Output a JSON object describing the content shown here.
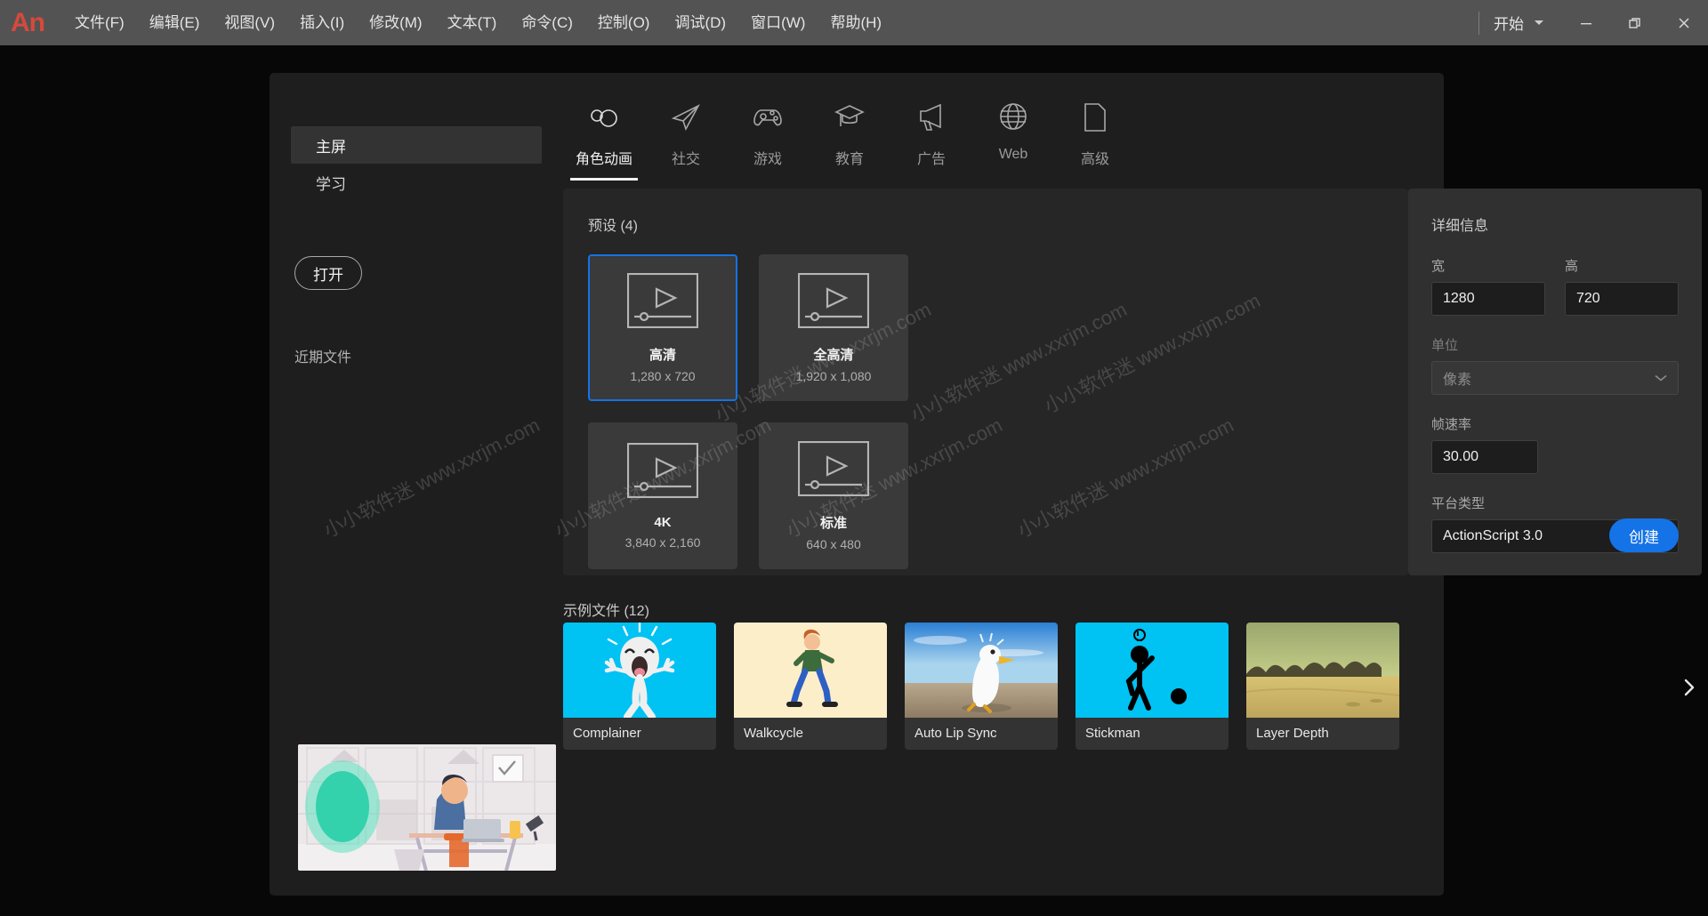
{
  "app": {
    "logo": "An"
  },
  "menubar": {
    "items": [
      {
        "label": "文件(F)",
        "name": "menu-file"
      },
      {
        "label": "编辑(E)",
        "name": "menu-edit"
      },
      {
        "label": "视图(V)",
        "name": "menu-view"
      },
      {
        "label": "插入(I)",
        "name": "menu-insert"
      },
      {
        "label": "修改(M)",
        "name": "menu-modify"
      },
      {
        "label": "文本(T)",
        "name": "menu-text"
      },
      {
        "label": "命令(C)",
        "name": "menu-commands"
      },
      {
        "label": "控制(O)",
        "name": "menu-control"
      },
      {
        "label": "调试(D)",
        "name": "menu-debug"
      },
      {
        "label": "窗口(W)",
        "name": "menu-window"
      },
      {
        "label": "帮助(H)",
        "name": "menu-help"
      }
    ],
    "workspace": "开始",
    "window_controls": {
      "minimize": "—",
      "restore": "❐",
      "close": "✕"
    }
  },
  "rail": {
    "items": [
      {
        "label": "主屏",
        "active": true
      },
      {
        "label": "学习",
        "active": false
      }
    ],
    "open_button": "打开",
    "recent_title": "近期文件"
  },
  "tabs": [
    {
      "label": "角色动画",
      "icon": "character-animation-icon",
      "active": true
    },
    {
      "label": "社交",
      "icon": "social-icon",
      "active": false
    },
    {
      "label": "游戏",
      "icon": "game-icon",
      "active": false
    },
    {
      "label": "教育",
      "icon": "education-icon",
      "active": false
    },
    {
      "label": "广告",
      "icon": "advertising-icon",
      "active": false
    },
    {
      "label": "Web",
      "icon": "web-globe-icon",
      "active": false
    },
    {
      "label": "高级",
      "icon": "advanced-document-icon",
      "active": false
    }
  ],
  "presets": {
    "heading": "预设 (4)",
    "items": [
      {
        "name": "高清",
        "dimensions": "1,280 x 720",
        "selected": true,
        "icon": "video-preview-icon"
      },
      {
        "name": "全高清",
        "dimensions": "1,920 x 1,080",
        "selected": false,
        "icon": "video-preview-icon"
      },
      {
        "name": "4K",
        "dimensions": "3,840 x 2,160",
        "selected": false,
        "icon": "video-preview-icon"
      },
      {
        "name": "标准",
        "dimensions": "640 x 480",
        "selected": false,
        "icon": "video-preview-icon"
      }
    ]
  },
  "details": {
    "heading": "详细信息",
    "width_label": "宽",
    "width_value": "1280",
    "height_label": "高",
    "height_value": "720",
    "units_label": "单位",
    "units_value": "像素",
    "framerate_label": "帧速率",
    "framerate_value": "30.00",
    "platform_label": "平台类型",
    "platform_value": "ActionScript 3.0",
    "create_button": "创建"
  },
  "samples": {
    "heading": "示例文件 (12)",
    "items": [
      {
        "name": "Complainer",
        "thumb": "complainer"
      },
      {
        "name": "Walkcycle",
        "thumb": "walkcycle"
      },
      {
        "name": "Auto Lip Sync",
        "thumb": "autolipsync"
      },
      {
        "name": "Stickman",
        "thumb": "stickman"
      },
      {
        "name": "Layer Depth",
        "thumb": "layerdepth"
      }
    ],
    "next_label": "›"
  },
  "watermark": {
    "text": "小小软件迷 www.xxrjm.com"
  },
  "colors": {
    "accent": "#1473e6",
    "titlebar": "#535353",
    "dialog_bg": "#1e1e1e",
    "panel_bg": "#262626",
    "details_bg": "#303030",
    "card_bg": "#3a3a3a",
    "logo_red": "#d44a3c"
  }
}
